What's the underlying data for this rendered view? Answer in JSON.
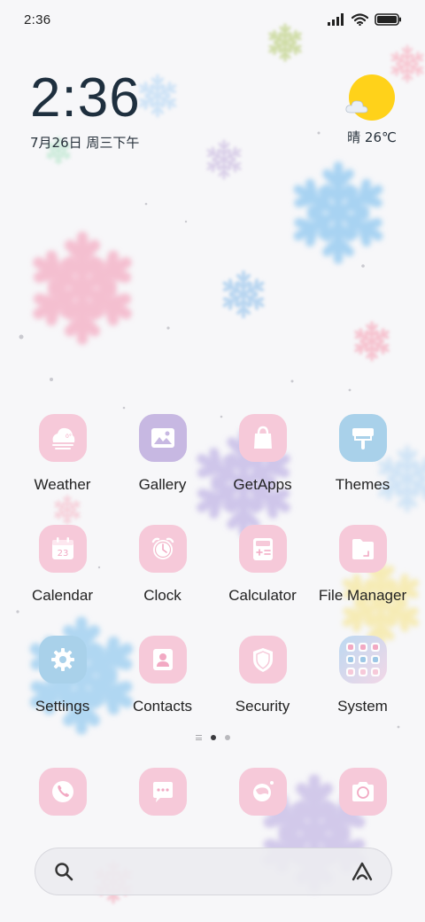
{
  "status_bar": {
    "time": "2:36"
  },
  "clock_widget": {
    "time": "2:36",
    "date": "7月26日 周三下午"
  },
  "weather_widget": {
    "condition": "晴",
    "temperature": "26℃",
    "icon": "sunny-with-cloud-icon",
    "sun_color": "#ffd21a"
  },
  "apps": {
    "row1": [
      {
        "label": "Weather",
        "icon": "weather-icon",
        "color": "#f6c9d9"
      },
      {
        "label": "Gallery",
        "icon": "gallery-icon",
        "color": "#c7b8e2"
      },
      {
        "label": "GetApps",
        "icon": "shopping-bag-icon",
        "color": "#f6c9d9"
      },
      {
        "label": "Themes",
        "icon": "paint-roller-icon",
        "color": "#a9d1ea"
      }
    ],
    "row2": [
      {
        "label": "Calendar",
        "icon": "calendar-icon",
        "color": "#f6c9d9",
        "day": "23"
      },
      {
        "label": "Clock",
        "icon": "alarm-clock-icon",
        "color": "#f6c9d9"
      },
      {
        "label": "Calculator",
        "icon": "calculator-icon",
        "color": "#f6c9d9"
      },
      {
        "label": "File Manager",
        "icon": "folder-icon",
        "color": "#f6c9d9"
      }
    ],
    "row3": [
      {
        "label": "Settings",
        "icon": "gear-icon",
        "color": "#a9d1ea"
      },
      {
        "label": "Contacts",
        "icon": "contact-card-icon",
        "color": "#f6c9d9"
      },
      {
        "label": "Security",
        "icon": "shield-icon",
        "color": "#f6c9d9"
      },
      {
        "label": "System",
        "icon": "system-folder-icon",
        "color": "#c8e3f5"
      }
    ]
  },
  "dock": [
    {
      "icon": "phone-icon"
    },
    {
      "icon": "messages-icon"
    },
    {
      "icon": "browser-icon"
    },
    {
      "icon": "camera-icon"
    }
  ],
  "page_indicator": {
    "pages": 2,
    "current": 1
  },
  "search_bar": {
    "left_icon": "search-icon",
    "right_icon": "assistant-icon"
  }
}
